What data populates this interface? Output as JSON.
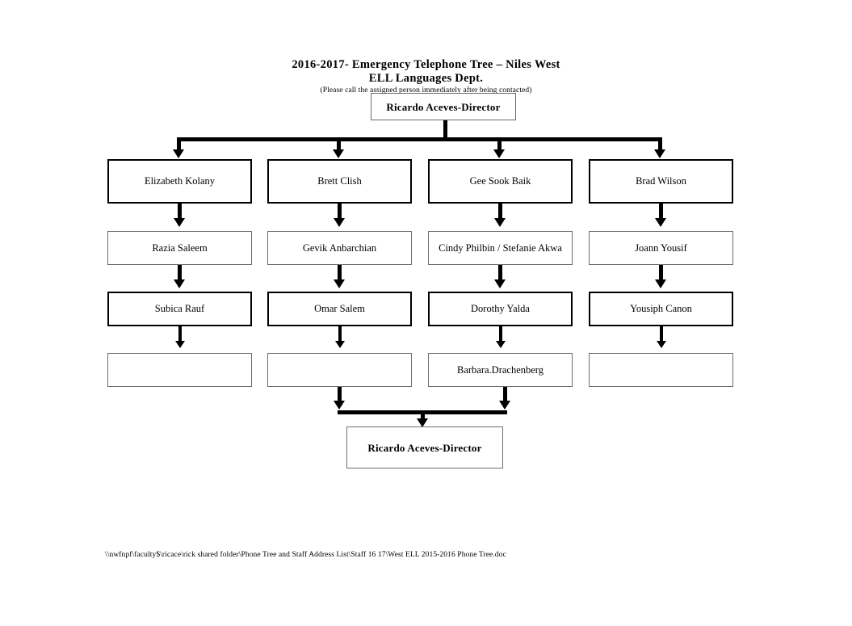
{
  "document": {
    "title_line1": "2016-2017- Emergency Telephone Tree – Niles West",
    "title_line2": "ELL Languages Dept.",
    "note": "(Please call the assigned person immediately after being contacted)",
    "footer_path": "\\\\nwfnpf\\faculty$\\ricace\\rick shared folder\\Phone Tree and Staff Address List\\Staff 16 17\\West ELL 2015-2016 Phone Tree.doc"
  },
  "chart_data": {
    "type": "diagram",
    "title": "2016-2017- Emergency Telephone Tree – Niles West ELL Languages Dept.",
    "root": "Ricardo Aceves-Director",
    "final": "Ricardo Aceves-Director",
    "columns": [
      {
        "level1": "Elizabeth Kolany",
        "level2": "Razia Saleem",
        "level3": "Subica Rauf",
        "level4": ""
      },
      {
        "level1": "Brett Clish",
        "level2": "Gevik Anbarchian",
        "level3": "Omar Salem",
        "level4": ""
      },
      {
        "level1": "Gee Sook Baik",
        "level2": "Cindy Philbin / Stefanie Akwa",
        "level3": "Dorothy Yalda",
        "level4": "Barbara.Drachenberg"
      },
      {
        "level1": "Brad Wilson",
        "level2": "Joann Yousif",
        "level3": "Yousiph Canon",
        "level4": ""
      }
    ]
  },
  "nodes": {
    "root": "Ricardo Aceves-Director",
    "r1c1": "Elizabeth Kolany",
    "r1c2": "Brett Clish",
    "r1c3": "Gee Sook Baik",
    "r1c4": "Brad Wilson",
    "r2c1": "Razia Saleem",
    "r2c2": "Gevik Anbarchian",
    "r2c3": "Cindy Philbin / Stefanie Akwa",
    "r2c4": "Joann Yousif",
    "r3c1": "Subica Rauf",
    "r3c2": "Omar Salem",
    "r3c3": "Dorothy Yalda",
    "r3c4": "Yousiph Canon",
    "r4c1": "",
    "r4c2": "",
    "r4c3": "Barbara.Drachenberg",
    "r4c4": "",
    "bottom": "Ricardo Aceves-Director"
  },
  "colors": {
    "ink": "#000000",
    "thin_border": "#6d6d6d",
    "page": "#ffffff"
  }
}
